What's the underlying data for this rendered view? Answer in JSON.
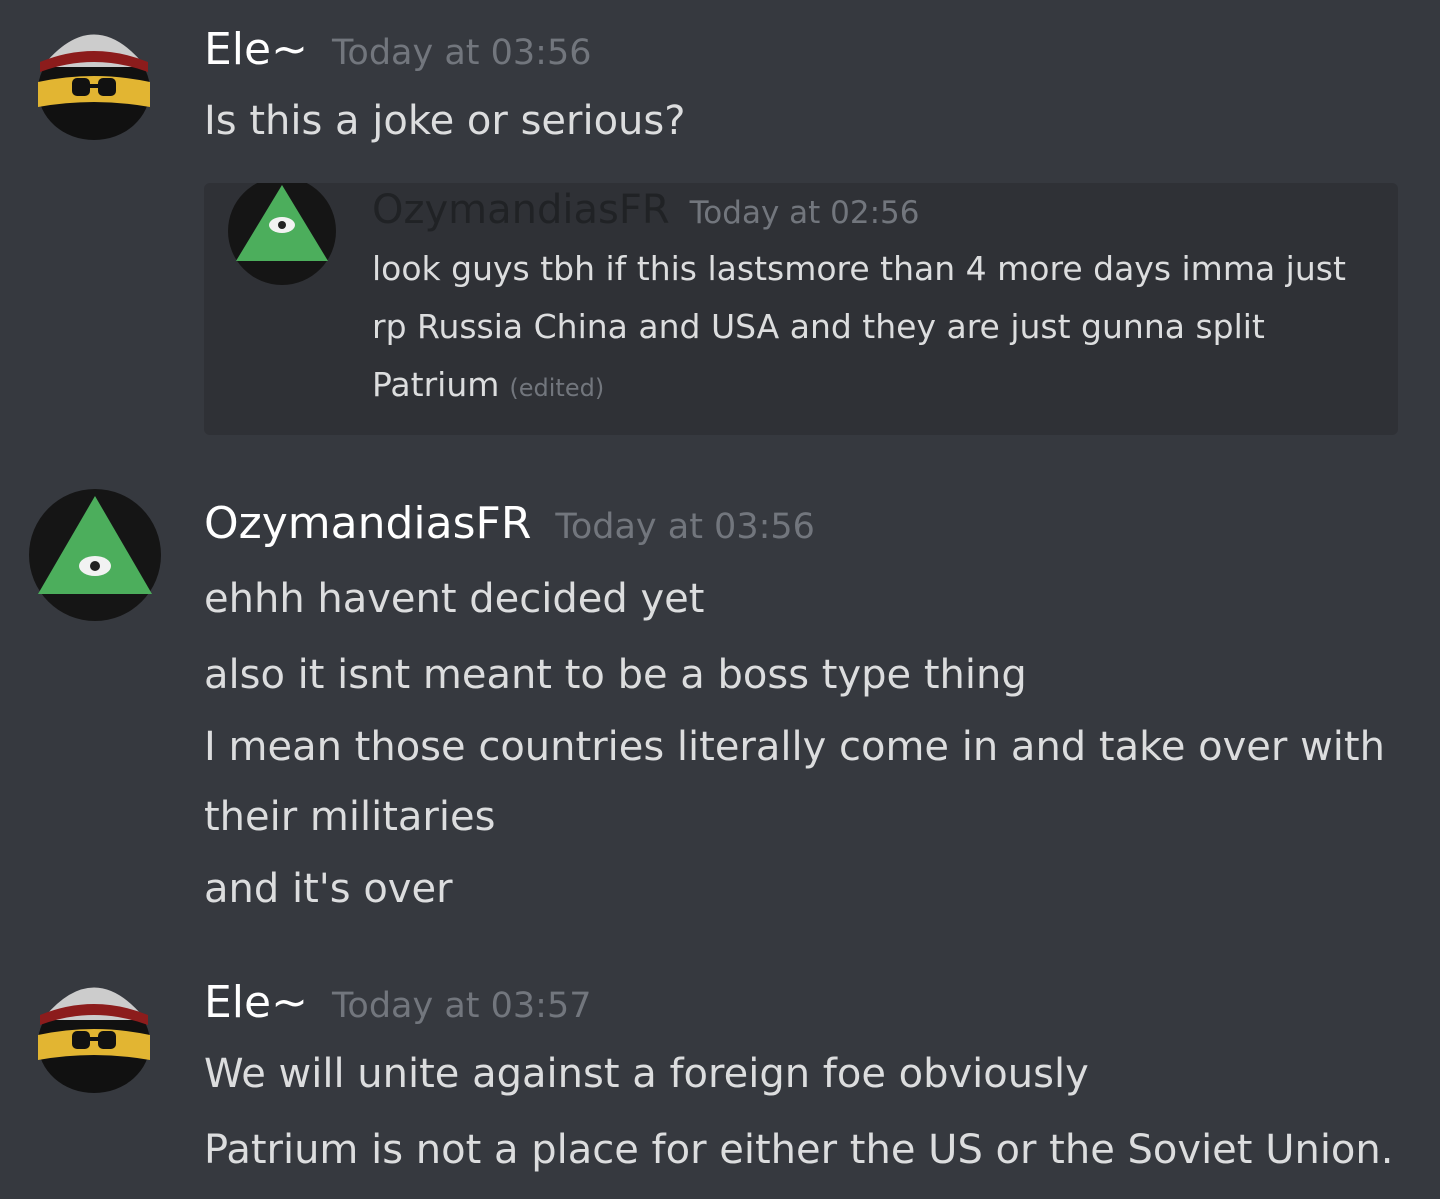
{
  "messages": [
    {
      "author": "Ele~",
      "timestamp": "Today at 03:56",
      "avatar_icon": "countryball-helmet-icon",
      "lines": [
        "Is this a joke or serious?"
      ],
      "quote": {
        "author": "OzymandiasFR",
        "timestamp": "Today at 02:56",
        "avatar_icon": "illuminati-pyramid-icon",
        "lines": [
          "look guys tbh if this lastsmore than 4 more days imma just",
          "rp Russia China and USA and they are just gunna split",
          "Patrium"
        ],
        "edited_label": "(edited)"
      }
    },
    {
      "author": "OzymandiasFR",
      "timestamp": "Today at 03:56",
      "avatar_icon": "illuminati-pyramid-icon",
      "lines": [
        "ehhh havent decided yet",
        "also it isnt meant to be a boss type thing",
        "I mean those countries literally come in and take over with",
        "their militaries",
        "and it's over"
      ]
    },
    {
      "author": "Ele~",
      "timestamp": "Today at 03:57",
      "avatar_icon": "countryball-helmet-icon",
      "lines": [
        "We will unite against a foreign foe obviously",
        "Patrium is not a place for either the US or the Soviet Union."
      ]
    }
  ],
  "colors": {
    "background": "#36393f",
    "embed_background": "#2f3136",
    "author": "#ffffff",
    "timestamp": "#72767d",
    "text": "#dcddde",
    "pyramid_green": "#4cae5c"
  }
}
